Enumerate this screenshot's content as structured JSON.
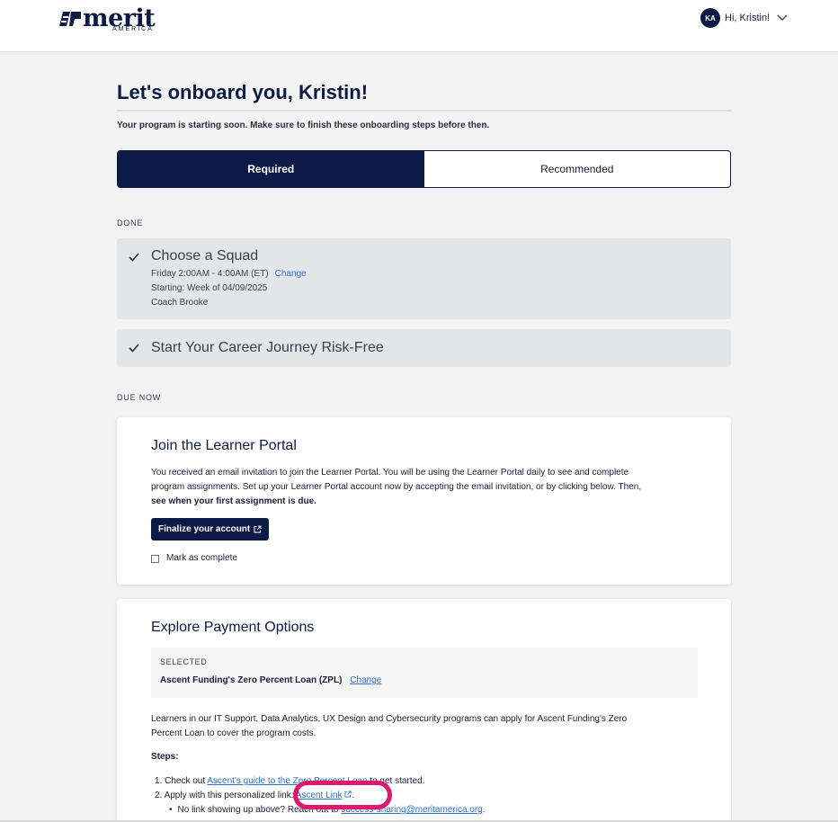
{
  "header": {
    "logo_word": "merit",
    "logo_sub": "AMERICA",
    "avatar_initials": "KA",
    "greeting": "Hi, Kristin!"
  },
  "page": {
    "title": "Let's onboard you, Kristin!",
    "subtitle": "Your program is starting soon. Make sure to finish these onboarding steps before then."
  },
  "tabs": [
    {
      "label": "Required",
      "active": true
    },
    {
      "label": "Recommended",
      "active": false
    }
  ],
  "done": {
    "section_label": "DONE",
    "items": [
      {
        "title": "Choose a Squad",
        "schedule": "Friday 2:00AM - 4:00AM (ET)",
        "change_label": "Change",
        "starting": "Starting: Week of 04/09/2025",
        "coach": "Coach Brooke"
      },
      {
        "title": "Start Your Career Journey Risk-Free"
      }
    ]
  },
  "due_now": {
    "section_label": "DUE NOW",
    "learner_portal": {
      "title": "Join the Learner Portal",
      "text_line1": "You received an email invitation to join the Learner Portal. You will be using the Learner Portal daily to see and complete",
      "text_line2": "program assignments. Set up your Learner Portal account now by accepting the email invitation, or by clicking below. Then,",
      "text_bold": "see when your first assignment is due.",
      "button_label": "Finalize your account",
      "checkbox_label": "Mark as complete"
    },
    "payment": {
      "title": "Explore Payment Options",
      "selected_label": "SELECTED",
      "selected_value": "Ascent Funding's Zero Percent Loan (ZPL)",
      "change_label": "Change",
      "text_line1": "Learners in our IT Support, Data Analytics, UX Design and Cybersecurity programs can apply for Ascent Funding's Zero",
      "text_line2": "Percent Loan to cover the program costs.",
      "steps_label": "Steps:",
      "step1_prefix": "1. Check out ",
      "step1_link": "Ascent's guide to the Zero Percent Loan",
      "step1_suffix": " to get started.",
      "step2_prefix": "2. Apply with this personalized link: ",
      "step2_link": "Ascent Link",
      "step2_suffix": ".",
      "bullet_prefix": "No link showing up above? Reach out to ",
      "bullet_link": "success-sharing@meritamerica.org",
      "bullet_suffix": "."
    }
  },
  "colors": {
    "navy": "#0c1b45",
    "link": "#2f6fd6",
    "highlight": "#e0156f",
    "done_bg": "#e3e5e8"
  }
}
